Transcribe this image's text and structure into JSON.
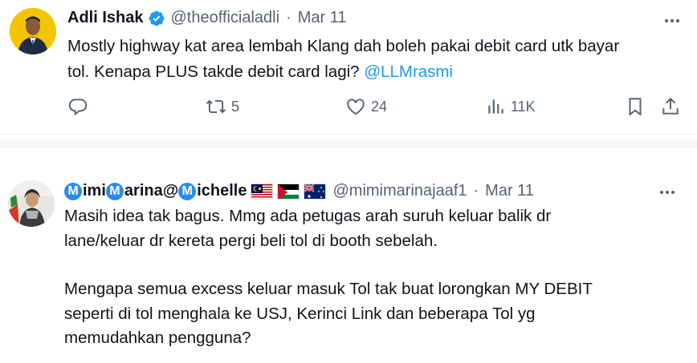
{
  "tweet1": {
    "name": "Adli Ishak",
    "handle": "@theofficialadli",
    "separator": "·",
    "date": "Mar 11",
    "line1": "Mostly highway kat area lembah Klang dah boleh pakai debit card utk bayar",
    "line2": "tol. Kenapa PLUS takde debit card lagi?",
    "mention": "@LLMrasmi",
    "retweets": "5",
    "likes": "24",
    "views": "11K"
  },
  "tweet2": {
    "name_m1": "M",
    "name_p1": "imi",
    "name_m2": "M",
    "name_p2": "arina@",
    "name_m3": "M",
    "name_p3": "ichelle",
    "handle": "@mimimarinajaaf1",
    "separator": "·",
    "date": "Mar 11",
    "para1_line1": "Masih idea tak bagus. Mmg ada petugas arah suruh keluar balik dr",
    "para1_line2": "lane/keluar dr kereta pergi beli tol di booth sebelah.",
    "para2_line1": "Mengapa semua excess keluar masuk Tol tak buat lorongkan MY DEBIT",
    "para2_line2": "seperti di tol menghala ke USJ, Kerinci Link dan beberapa Tol yg",
    "para2_line3": "memudahkan pengguna?"
  },
  "colors": {
    "text": "#0f1419",
    "secondary": "#536471",
    "accent": "#1d9bf0"
  }
}
